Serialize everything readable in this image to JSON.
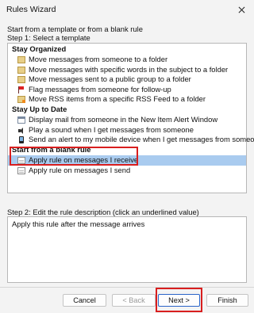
{
  "window": {
    "title": "Rules Wizard"
  },
  "wizard": {
    "intro": "Start from a template or from a blank rule",
    "step1_label": "Step 1: Select a template",
    "step2_label": "Step 2: Edit the rule description (click an underlined value)",
    "description": "Apply this rule after the message arrives"
  },
  "templates": {
    "stay_organized": {
      "header": "Stay Organized",
      "items": [
        {
          "label": "Move messages from someone to a folder",
          "icon": "envelope-icon"
        },
        {
          "label": "Move messages with specific words in the subject to a folder",
          "icon": "envelope-icon"
        },
        {
          "label": "Move messages sent to a public group to a folder",
          "icon": "envelope-icon"
        },
        {
          "label": "Flag messages from someone for follow-up",
          "icon": "flag-icon"
        },
        {
          "label": "Move RSS items from a specific RSS Feed to a folder",
          "icon": "rss-icon"
        }
      ]
    },
    "stay_up_to_date": {
      "header": "Stay Up to Date",
      "items": [
        {
          "label": "Display mail from someone in the New Item Alert Window",
          "icon": "window-icon"
        },
        {
          "label": "Play a sound when I get messages from someone",
          "icon": "speaker-icon"
        },
        {
          "label": "Send an alert to my mobile device when I get messages from someone",
          "icon": "phone-icon"
        }
      ]
    },
    "blank_rule": {
      "header": "Start from a blank rule",
      "items": [
        {
          "label": "Apply rule on messages I receive",
          "icon": "blank-rule-icon",
          "selected": true
        },
        {
          "label": "Apply rule on messages I send",
          "icon": "blank-rule-icon",
          "selected": false
        }
      ]
    }
  },
  "buttons": {
    "cancel": "Cancel",
    "back": "< Back",
    "next": "Next >",
    "finish": "Finish"
  },
  "colors": {
    "selection": "#a9cbef",
    "highlight_box": "#d81e1e",
    "window_bg": "#f3f3f3"
  }
}
